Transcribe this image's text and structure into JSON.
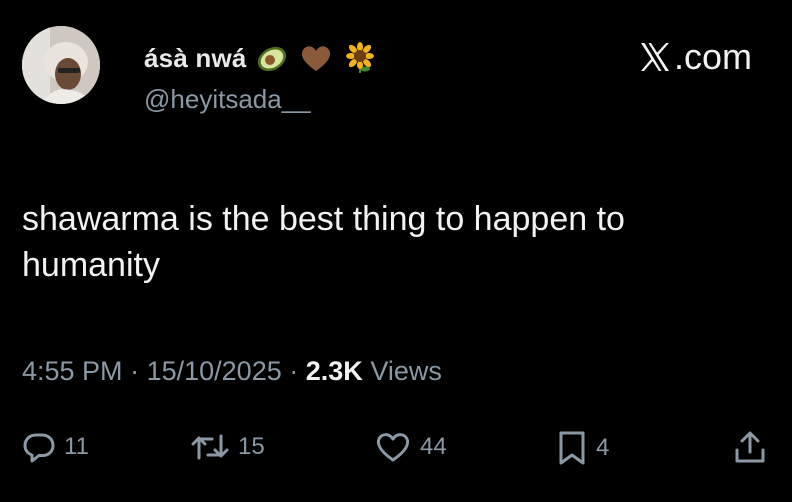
{
  "author": {
    "display_name": "ásà nwá",
    "handle": "@heyitsada__",
    "name_emojis": [
      "avocado-icon",
      "brown-heart-icon",
      "sunflower-icon"
    ]
  },
  "brand": {
    "text": ".com",
    "logo": "x-logo-icon"
  },
  "tweet": {
    "text": "shawarma is the best thing to happen to humanity"
  },
  "meta": {
    "time": "4:55 PM",
    "separator": "·",
    "date": "15/10/2025",
    "views_count": "2.3K",
    "views_label": "Views"
  },
  "actions": {
    "replies": "11",
    "reposts": "15",
    "likes": "44",
    "bookmarks": "4"
  },
  "colors": {
    "background": "#000000",
    "text": "#e7e9ea",
    "secondary": "#8b98a5"
  }
}
